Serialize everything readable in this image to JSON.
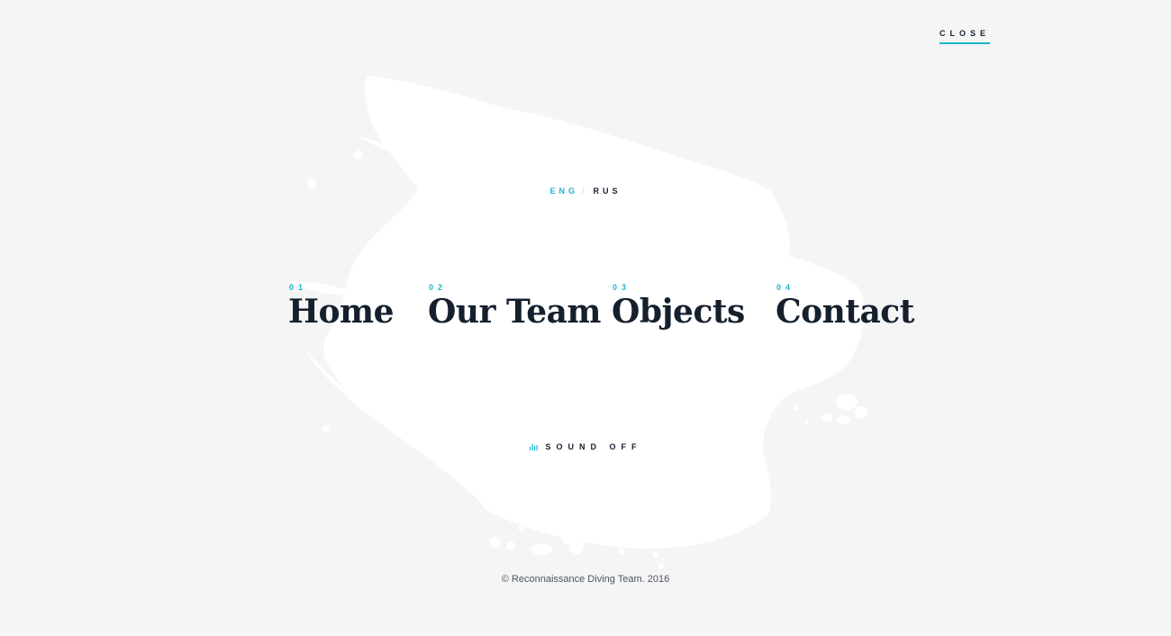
{
  "header": {
    "close_label": "CLOSE"
  },
  "language": {
    "eng_label": "ENG",
    "separator": "/",
    "rus_label": "RUS",
    "active": "ENG"
  },
  "nav": {
    "items": [
      {
        "number": "01",
        "label": "Home"
      },
      {
        "number": "02",
        "label": "Our Team"
      },
      {
        "number": "03",
        "label": "Objects"
      },
      {
        "number": "04",
        "label": "Contact"
      }
    ]
  },
  "sound": {
    "icon": "sound-bars-icon",
    "label": "SOUND OFF"
  },
  "footer": {
    "copyright": "© Reconnaissance Diving Team. 2016"
  },
  "colors": {
    "background": "#f5f5f5",
    "accent": "#1cb4cf",
    "text": "#15202e",
    "brush": "#ffffff"
  }
}
